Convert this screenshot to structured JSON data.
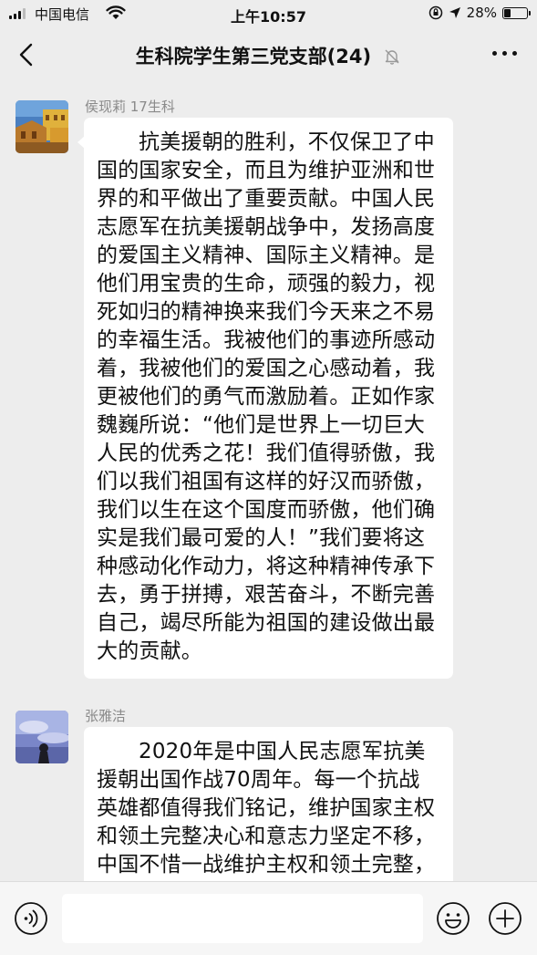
{
  "status_bar": {
    "carrier": "中国电信",
    "time": "上午10:57",
    "battery": "28%",
    "battery_level": 0.28
  },
  "nav": {
    "title": "生科院学生第三党支部(24)"
  },
  "messages": [
    {
      "sender": "侯现莉 17生科",
      "text": "抗美援朝的胜利，不仅保卫了中国的国家安全，而且为维护亚洲和世界的和平做出了重要贡献。中国人民志愿军在抗美援朝战争中，发扬高度的爱国主义精神、国际主义精神。是他们用宝贵的生命，顽强的毅力，视死如归的精神换来我们今天来之不易的幸福生活。我被他们的事迹所感动着，我被他们的爱国之心感动着，我更被他们的勇气而激励着。正如作家魏巍所说：“他们是世界上一切巨大人民的优秀之花！我们值得骄傲，我们以我们祖国有这样的好汉而骄傲，我们以生在这个国度而骄傲，他们确实是我们最可爱的人！”我们要将这种感动化作动力，将这种精神传承下去，勇于拼搏，艰苦奋斗，不断完善自己，竭尽所能为祖国的建设做出最大的贡献。"
    },
    {
      "sender": "张雅洁",
      "text": "2020年是中国人民志愿军抗美援朝出国作战70周年。每一个抗战英雄都值得我们铭记，维护国家主权和领土完整决心和意志力坚定不移，中国不惜一战维护主权和领土完整，中国在抗相主权，历强"
    }
  ],
  "input": {
    "value": "",
    "placeholder": ""
  }
}
